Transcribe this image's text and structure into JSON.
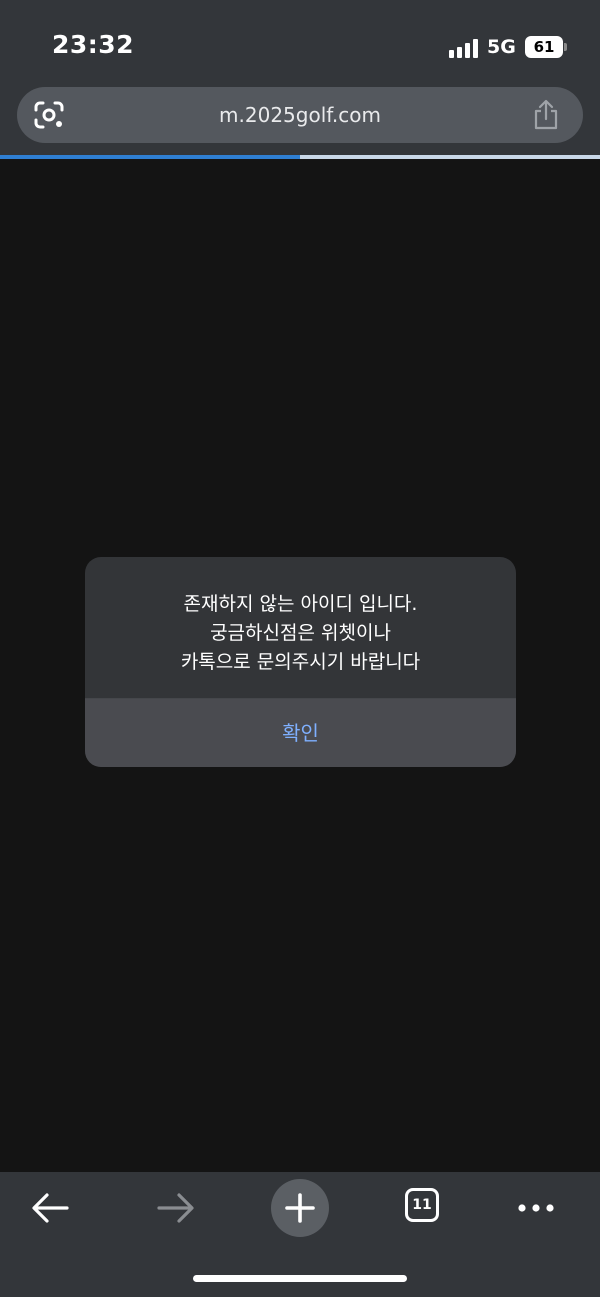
{
  "status_bar": {
    "time": "23:32",
    "network": "5G",
    "battery": "61"
  },
  "browser": {
    "url": "m.2025golf.com",
    "load_progress": 0.5,
    "accent_color": "#2f7fd3",
    "icons": {
      "lens": "google-lens-icon",
      "share": "share-icon"
    }
  },
  "dialog": {
    "message_lines": [
      "존재하지 않는 아이디 입니다.",
      "궁금하신점은 위쳇이나",
      "카톡으로 문의주시기 바랍니다"
    ],
    "confirm_label": "확인",
    "confirm_color": "#7fb0ff"
  },
  "toolbar": {
    "tab_count": "11",
    "icons": {
      "back": "back-arrow-icon",
      "forward": "forward-arrow-icon",
      "new_tab": "plus-icon",
      "tabs": "tabs-icon",
      "more": "more-dots-icon"
    }
  }
}
